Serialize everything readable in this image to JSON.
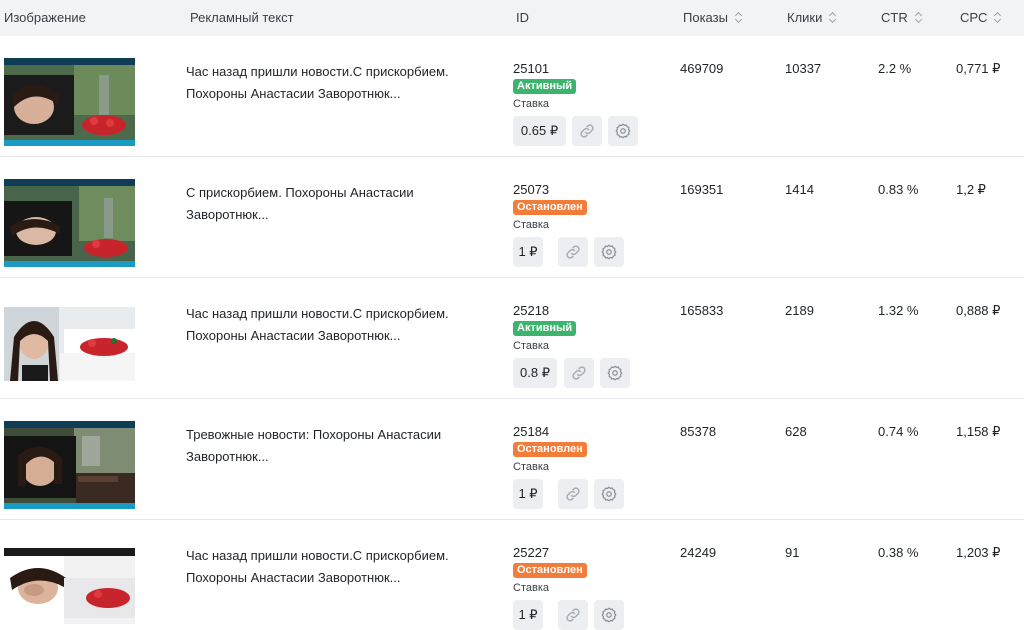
{
  "header": {
    "image": "Изображение",
    "ad_text": "Рекламный текст",
    "id": "ID",
    "impressions": "Показы",
    "clicks": "Клики",
    "ctr": "CTR",
    "cpc": "CPC"
  },
  "bid_label": "Ставка",
  "rows": [
    {
      "text_line1": "Час назад пришли новости.С прискорбием.",
      "text_line2": "Похороны Анастасии Заворотнюк...",
      "id": "25101",
      "status": "Активный",
      "bid": "0.65 ₽",
      "impressions": "469709",
      "clicks": "10337",
      "ctr": "2.2 %",
      "cpc": "0,771 ₽"
    },
    {
      "text_line1": "С прискорбием. Похороны Анастасии",
      "text_line2": "Заворотнюк...",
      "id": "25073",
      "status": "Остановлен",
      "bid": "1 ₽",
      "impressions": "169351",
      "clicks": "1414",
      "ctr": "0.83 %",
      "cpc": "1,2 ₽"
    },
    {
      "text_line1": "Час назад пришли новости.С прискорбием.",
      "text_line2": "Похороны Анастасии Заворотнюк...",
      "id": "25218",
      "status": "Активный",
      "bid": "0.8 ₽",
      "impressions": "165833",
      "clicks": "2189",
      "ctr": "1.32 %",
      "cpc": "0,888 ₽"
    },
    {
      "text_line1": "Тревожные новости: Похороны Анастасии",
      "text_line2": "Заворотнюк...",
      "id": "25184",
      "status": "Остановлен",
      "bid": "1 ₽",
      "impressions": "85378",
      "clicks": "628",
      "ctr": "0.74 %",
      "cpc": "1,158 ₽"
    },
    {
      "text_line1": "Час назад пришли новости.С прискорбием.",
      "text_line2": "Похороны Анастасии Заворотнюк...",
      "id": "25227",
      "status": "Остановлен",
      "bid": "1 ₽",
      "impressions": "24249",
      "clicks": "91",
      "ctr": "0.38 %",
      "cpc": "1,203 ₽"
    }
  ],
  "colors": {
    "active": "#3cb46e",
    "stopped": "#f27c3a",
    "header_bg": "#f2f3f5"
  },
  "icons": [
    "sort-icon",
    "link-icon",
    "gear-icon"
  ]
}
